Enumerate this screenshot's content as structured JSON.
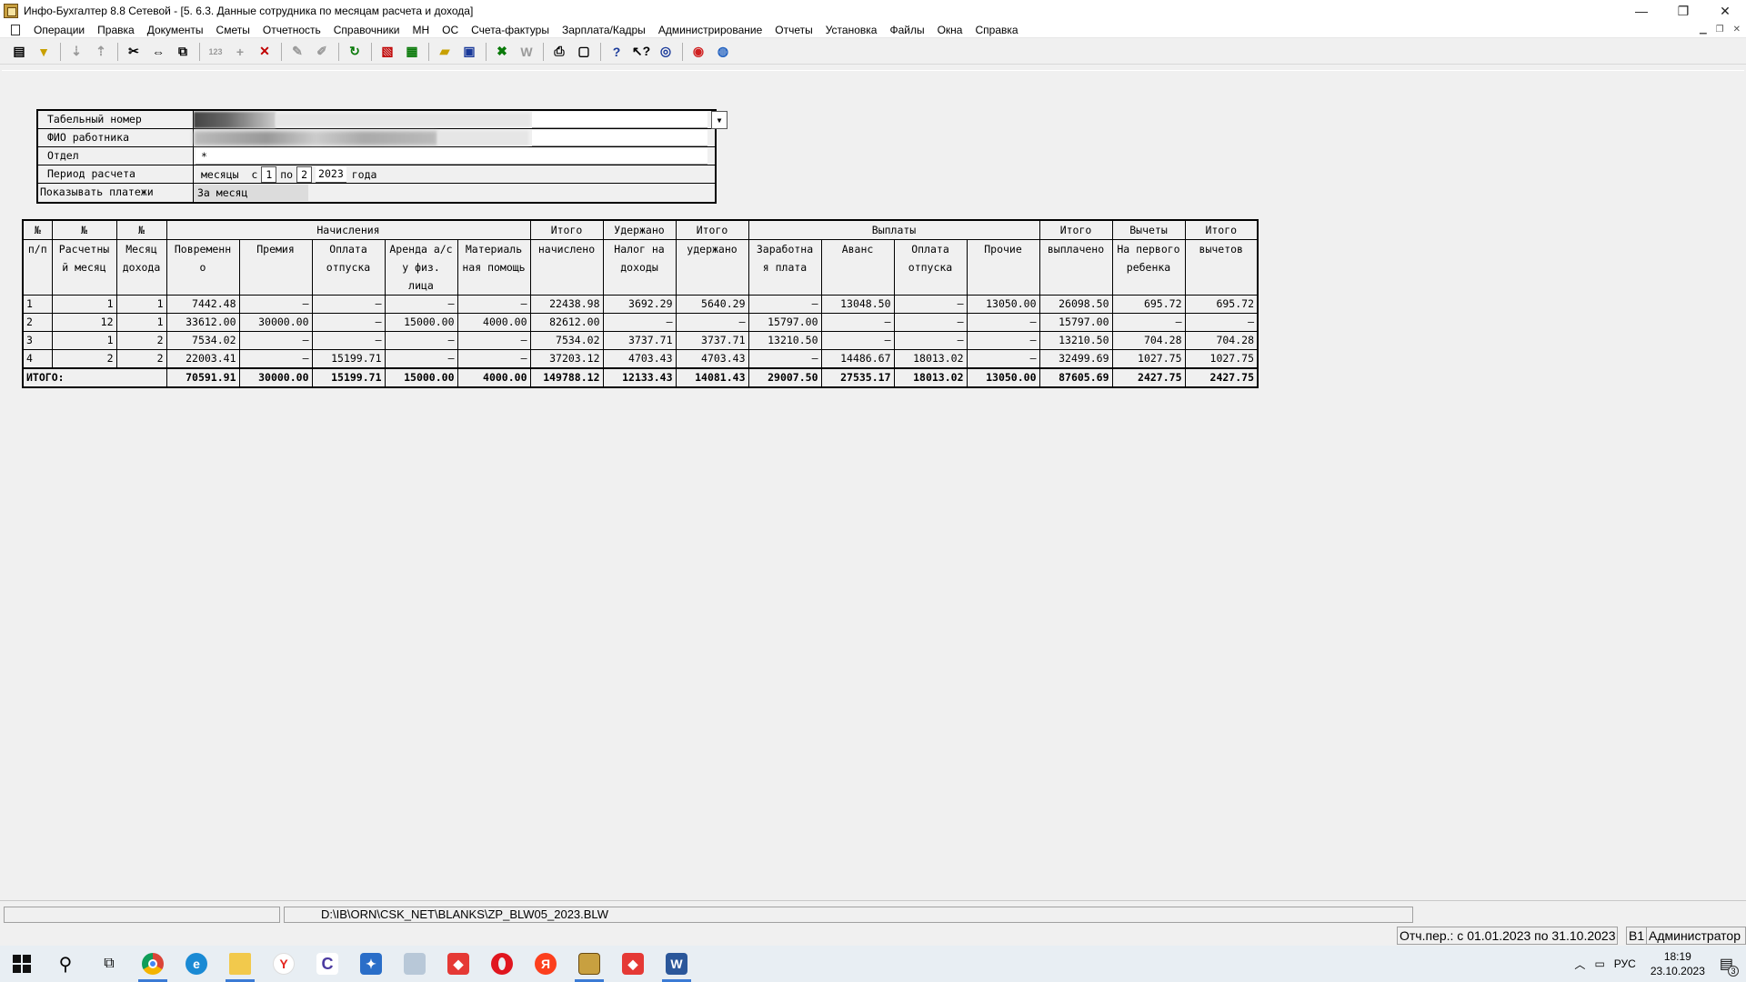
{
  "window": {
    "title": "Инфо-Бухгалтер 8.8 Сетевой - [5. 6.3. Данные сотрудника по месяцам расчета и дохода]",
    "controls": [
      "—",
      "❐",
      "✕"
    ]
  },
  "menu": [
    "Операции",
    "Правка",
    "Документы",
    "Сметы",
    "Отчетность",
    "Справочники",
    "МН",
    "ОС",
    "Счета-фактуры",
    "Зарплата/Кадры",
    "Администрирование",
    "Отчеты",
    "Установка",
    "Файлы",
    "Окна",
    "Справка"
  ],
  "toolbar_icons": [
    "form-view-icon",
    "filter-icon",
    "sort-asc-icon",
    "sort-desc-icon",
    "cut-icon",
    "move-icon",
    "copy-icon",
    "numbering-icon",
    "add-icon",
    "delete-icon",
    "mark-icon",
    "unmark-icon",
    "refresh-icon",
    "pdf-icon",
    "calculator-icon",
    "open-folder-icon",
    "save-icon",
    "excel-icon",
    "word-icon",
    "print-icon",
    "preview-icon",
    "help-icon",
    "context-help-icon",
    "compass-icon",
    "lifebuoy-icon",
    "globe-icon"
  ],
  "params": {
    "labels": {
      "tab_number": "Табельный номер",
      "fio": "ФИО работника",
      "dept": "Отдел",
      "period": "Период расчета",
      "show": "Показывать платежи"
    },
    "dept_value": "*",
    "period": {
      "prefix": "месяцы  с",
      "from": "1",
      "mid": "по",
      "to": "2",
      "year": "2023",
      "suffix": "года"
    },
    "show_value": "За месяц"
  },
  "table": {
    "h": {
      "num_top": "№",
      "num_bottom": "п/п",
      "calcmonth_top": "№",
      "calcmonth_bottom": "Расчетны й месяц",
      "incmonth_top": "№",
      "incmonth_bottom": "Месяц дохода",
      "accruals": "Начисления",
      "piece": "Повременн о",
      "bonus": "Премия",
      "vacation": "Оплата отпуска",
      "rent": "Аренда а/с у физ. лица",
      "aid": "Материаль ная помощь",
      "total_acc_top": "Итого",
      "total_acc_bottom": "начислено",
      "withheld_top": "Удержано",
      "tax": "Налог на доходы",
      "total_wh_top": "Итого",
      "total_wh_bottom": "удержано",
      "payments": "Выплаты",
      "salary": "Заработна я плата",
      "advance": "Аванс",
      "vac_pay": "Оплата отпуска",
      "other": "Прочие",
      "total_paid_top": "Итого",
      "total_paid_bottom": "выплачено",
      "deductions_top": "Вычеты",
      "first_child": "На первого ребенка",
      "total_ded_top": "Итого",
      "total_ded_bottom": "вычетов"
    },
    "rows": [
      [
        "1",
        "1",
        "1",
        "7442.48",
        "–",
        "–",
        "–",
        "–",
        "22438.98",
        "3692.29",
        "5640.29",
        "–",
        "13048.50",
        "–",
        "13050.00",
        "26098.50",
        "695.72",
        "695.72"
      ],
      [
        "2",
        "12",
        "1",
        "33612.00",
        "30000.00",
        "–",
        "15000.00",
        "4000.00",
        "82612.00",
        "–",
        "–",
        "15797.00",
        "–",
        "–",
        "–",
        "15797.00",
        "–",
        "–"
      ],
      [
        "3",
        "1",
        "2",
        "7534.02",
        "–",
        "–",
        "–",
        "–",
        "7534.02",
        "3737.71",
        "3737.71",
        "13210.50",
        "–",
        "–",
        "–",
        "13210.50",
        "704.28",
        "704.28"
      ],
      [
        "4",
        "2",
        "2",
        "22003.41",
        "–",
        "15199.71",
        "–",
        "–",
        "37203.12",
        "4703.43",
        "4703.43",
        "–",
        "14486.67",
        "18013.02",
        "–",
        "32499.69",
        "1027.75",
        "1027.75"
      ]
    ],
    "total_label": "ИТОГО:",
    "totals": [
      "70591.91",
      "30000.00",
      "15199.71",
      "15000.00",
      "4000.00",
      "149788.12",
      "12133.43",
      "14081.43",
      "29007.50",
      "27535.17",
      "18013.02",
      "13050.00",
      "87605.69",
      "2427.75",
      "2427.75"
    ]
  },
  "status": {
    "path": "D:\\IB\\ORN\\CSK_NET\\BLANKS\\ZP_BLW05_2023.BLW",
    "period": "Отч.пер.: с 01.01.2023 по 31.10.2023",
    "db": "В1",
    "user": "Администратор"
  },
  "taskbar": {
    "lang": "РУС",
    "time": "18:19",
    "date": "23.10.2023",
    "notif_count": "3"
  }
}
